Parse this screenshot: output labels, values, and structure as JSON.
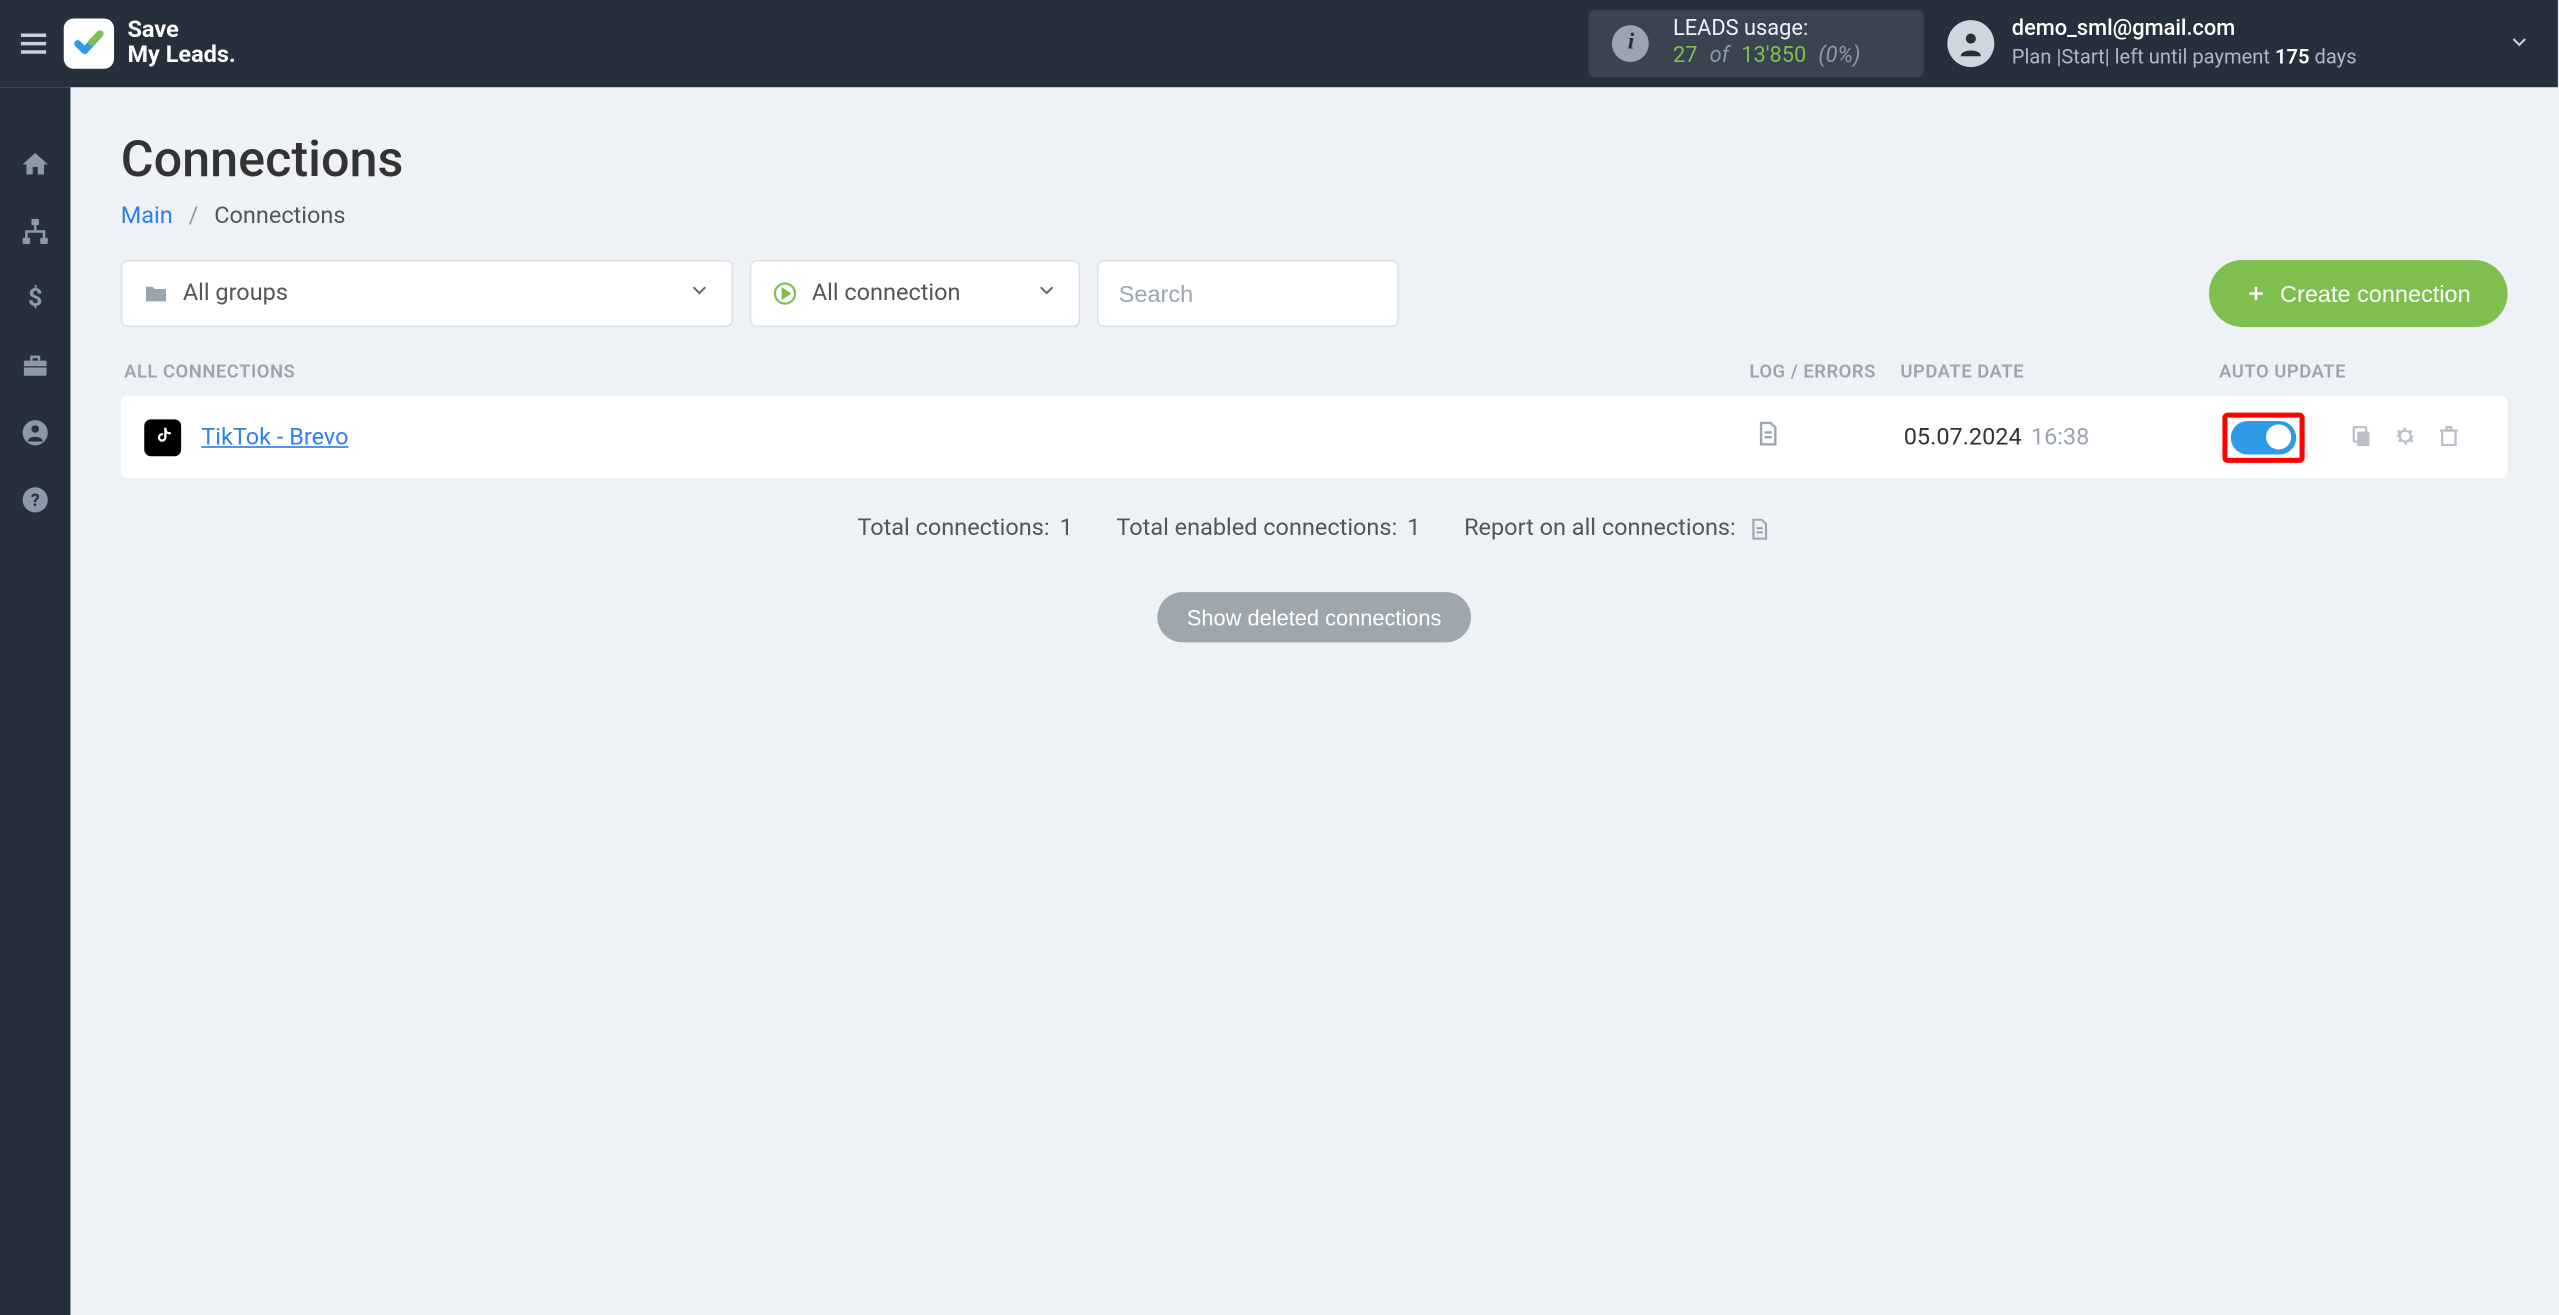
{
  "brand": {
    "line1": "Save",
    "line2": "My Leads."
  },
  "usage": {
    "label": "LEADS usage:",
    "used": "27",
    "of": "of",
    "total": "13'850",
    "pct": "(0%)"
  },
  "user": {
    "email": "demo_sml@gmail.com",
    "plan_prefix": "Plan |Start| left until payment ",
    "plan_days": "175",
    "plan_suffix": " days"
  },
  "page": {
    "title": "Connections"
  },
  "breadcrumbs": {
    "main": "Main",
    "sep": "/",
    "current": "Connections"
  },
  "filters": {
    "groups_label": "All groups",
    "conn_label": "All connection",
    "search_placeholder": "Search"
  },
  "create_btn": "Create connection",
  "headers": {
    "all": "ALL CONNECTIONS",
    "log": "LOG / ERRORS",
    "date": "UPDATE DATE",
    "auto": "AUTO UPDATE"
  },
  "rows": [
    {
      "name": "TikTok - Brevo",
      "date": "05.07.2024",
      "time": "16:38",
      "toggle": true
    }
  ],
  "stats": {
    "total_label": "Total connections: ",
    "total_val": "1",
    "enabled_label": "Total enabled connections: ",
    "enabled_val": "1",
    "report_label": "Report on all connections:"
  },
  "show_deleted": "Show deleted connections"
}
